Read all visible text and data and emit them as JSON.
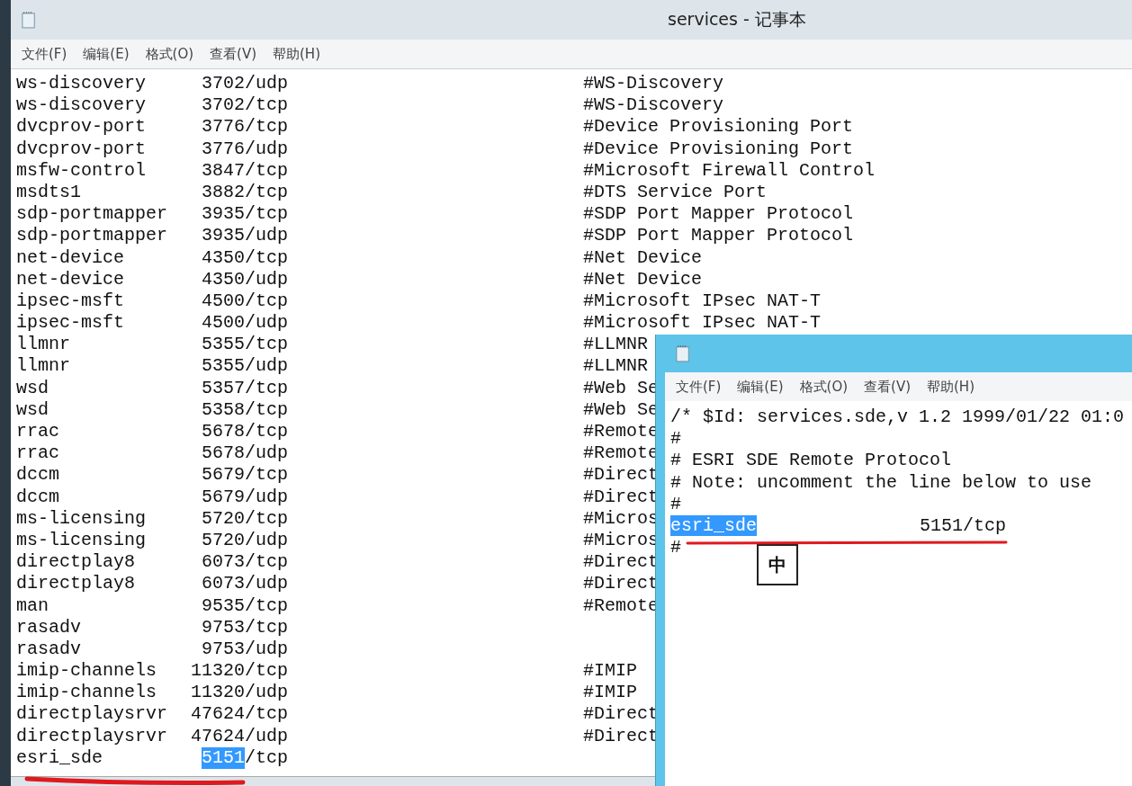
{
  "main_window": {
    "title": "services - 记事本",
    "menu": [
      "文件(F)",
      "编辑(E)",
      "格式(O)",
      "查看(V)",
      "帮助(H)"
    ],
    "lines": [
      {
        "name": "ws-discovery",
        "port": "3702/udp",
        "comment": "#WS-Discovery"
      },
      {
        "name": "ws-discovery",
        "port": "3702/tcp",
        "comment": "#WS-Discovery"
      },
      {
        "name": "dvcprov-port",
        "port": "3776/tcp",
        "comment": "#Device Provisioning Port"
      },
      {
        "name": "dvcprov-port",
        "port": "3776/udp",
        "comment": "#Device Provisioning Port"
      },
      {
        "name": "msfw-control",
        "port": "3847/tcp",
        "comment": "#Microsoft Firewall Control"
      },
      {
        "name": "msdts1",
        "port": "3882/tcp",
        "comment": "#DTS Service Port"
      },
      {
        "name": "sdp-portmapper",
        "port": "3935/tcp",
        "comment": "#SDP Port Mapper Protocol"
      },
      {
        "name": "sdp-portmapper",
        "port": "3935/udp",
        "comment": "#SDP Port Mapper Protocol"
      },
      {
        "name": "net-device",
        "port": "4350/tcp",
        "comment": "#Net Device"
      },
      {
        "name": "net-device",
        "port": "4350/udp",
        "comment": "#Net Device"
      },
      {
        "name": "ipsec-msft",
        "port": "4500/tcp",
        "comment": "#Microsoft IPsec NAT-T"
      },
      {
        "name": "ipsec-msft",
        "port": "4500/udp",
        "comment": "#Microsoft IPsec NAT-T"
      },
      {
        "name": "llmnr",
        "port": "5355/tcp",
        "comment": "#LLMNR"
      },
      {
        "name": "llmnr",
        "port": "5355/udp",
        "comment": "#LLMNR"
      },
      {
        "name": "wsd",
        "port": "5357/tcp",
        "comment": "#Web Se"
      },
      {
        "name": "wsd",
        "port": "5358/tcp",
        "comment": "#Web Se"
      },
      {
        "name": "rrac",
        "port": "5678/tcp",
        "comment": "#Remote"
      },
      {
        "name": "rrac",
        "port": "5678/udp",
        "comment": "#Remote"
      },
      {
        "name": "dccm",
        "port": "5679/tcp",
        "comment": "#Direct"
      },
      {
        "name": "dccm",
        "port": "5679/udp",
        "comment": "#Direct"
      },
      {
        "name": "ms-licensing",
        "port": "5720/tcp",
        "comment": "#Micros"
      },
      {
        "name": "ms-licensing",
        "port": "5720/udp",
        "comment": "#Micros"
      },
      {
        "name": "directplay8",
        "port": "6073/tcp",
        "comment": "#Direct"
      },
      {
        "name": "directplay8",
        "port": "6073/udp",
        "comment": "#Direct"
      },
      {
        "name": "man",
        "port": "9535/tcp",
        "comment": "#Remote"
      },
      {
        "name": "rasadv",
        "port": "9753/tcp"
      },
      {
        "name": "rasadv",
        "port": "9753/udp"
      },
      {
        "name": "imip-channels",
        "port": "11320/tcp",
        "comment": "#IMIP"
      },
      {
        "name": "imip-channels",
        "port": "11320/udp",
        "comment": "#IMIP"
      },
      {
        "name": "directplaysrvr",
        "port": "47624/tcp",
        "comment": "#Direct"
      },
      {
        "name": "directplaysrvr",
        "port": "47624/udp",
        "comment": "#Direct"
      },
      {
        "name": "esri_sde",
        "port_segments": [
          {
            "text": "5151",
            "selected": true
          },
          {
            "text": "/tcp",
            "selected": false
          }
        ]
      }
    ]
  },
  "second_window": {
    "menu": [
      "文件(F)",
      "编辑(E)",
      "格式(O)",
      "查看(V)",
      "帮助(H)"
    ],
    "lines": [
      {
        "text": "/* $Id: services.sde,v 1.2 1999/01/22 01:0"
      },
      {
        "text": "#"
      },
      {
        "text": "# ESRI SDE Remote Protocol"
      },
      {
        "text": "#   Note:  uncomment the line below to use"
      },
      {
        "text": "#"
      },
      {
        "name": "esri_sde",
        "name_selected": true,
        "port": "5151/tcp"
      },
      {
        "text": "#"
      }
    ],
    "ime_indicator": "中"
  }
}
